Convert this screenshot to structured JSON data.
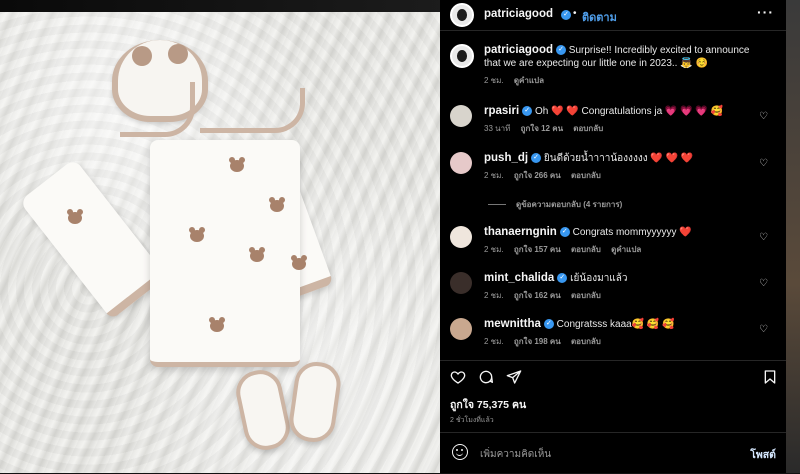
{
  "colors": {
    "accent": "#3897f0",
    "follow": "#4f9de8",
    "like": "#ed2b4a"
  },
  "header": {
    "username": "patriciagood",
    "separator": "•",
    "follow_label": "ติดตาม",
    "more_icon": "more-dots-icon"
  },
  "caption": {
    "username": "patriciagood",
    "text": "Surprise!! Incredibly excited to announce that we are expecting our little one in 2023.. 👼 ☺️",
    "time": "2 ชม.",
    "translate": "ดูคำแปล"
  },
  "comments": [
    {
      "username": "rpasiri",
      "text": "Oh ❤️ ❤️ Congratulations ja 💗 💗 💗 🥰",
      "time": "33 นาที",
      "likes": "ถูกใจ 12 คน",
      "reply": "ตอบกลับ",
      "translate": ""
    },
    {
      "username": "push_dj",
      "text": "ยินดีด้วยน้ำาาาน้องงงงง ❤️ ❤️ ❤️",
      "time": "2 ชม.",
      "likes": "ถูกใจ 266 คน",
      "reply": "ตอบกลับ",
      "translate": "",
      "view_replies": "ดูข้อความตอบกลับ (4 รายการ)"
    },
    {
      "username": "thanaerngnin",
      "text": "Congrats mommyyyyyy ❤️",
      "time": "2 ชม.",
      "likes": "ถูกใจ 157 คน",
      "reply": "ตอบกลับ",
      "translate": "ดูคำแปล"
    },
    {
      "username": "mint_chalida",
      "text": "เย้น้องมาแล้ว",
      "time": "2 ชม.",
      "likes": "ถูกใจ 162 คน",
      "reply": "ตอบกลับ",
      "translate": ""
    },
    {
      "username": "mewnittha",
      "text": "Congratsss kaaa🥰 🥰 🥰",
      "time": "2 ชม.",
      "likes": "ถูกใจ 198 คน",
      "reply": "ตอบกลับ",
      "translate": ""
    }
  ],
  "actions": {
    "like_icon": "heart-icon",
    "comment_icon": "comment-icon",
    "share_icon": "share-icon",
    "save_icon": "bookmark-icon"
  },
  "likes_count": "ถูกใจ 75,375 คน",
  "post_time": "2 ชั่วโมงที่แล้ว",
  "compose": {
    "placeholder": "เพิ่มความคิดเห็น",
    "post_label": "โพสต์",
    "emoji_icon": "emoji-icon"
  }
}
